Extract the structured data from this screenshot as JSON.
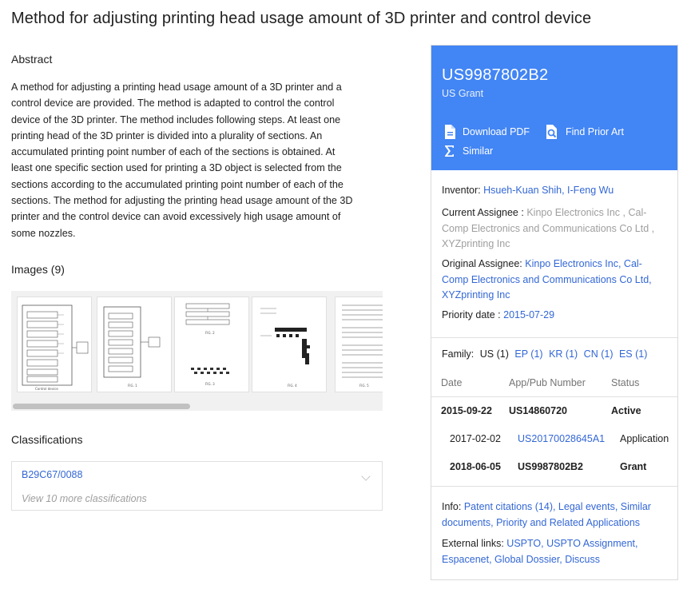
{
  "title": "Method for adjusting printing head usage amount of 3D printer and control device",
  "abstract": {
    "heading": "Abstract",
    "lines": [
      "A method for adjusting a printing head usage amount of a 3D printer and a",
      "control device are provided. The method is adapted to control the control",
      "device of the 3D printer. The method includes following steps. At least one",
      "printing head of the 3D printer is divided into a plurality of sections. An",
      "accumulated printing point number of each of the sections is obtained. At",
      "least one specific section used for printing a 3D object is selected from the",
      "sections according to the accumulated printing point number of each of the",
      "sections. The method for adjusting the printing head usage amount of the 3D",
      "printer and the control device can avoid excessively high usage amount of",
      "some nozzles."
    ]
  },
  "images": {
    "heading": "Images (9)",
    "thumbnails": [
      {
        "caption": "Control device"
      },
      {
        "caption": "FIG. 1"
      },
      {
        "caption": "FIG. 2"
      },
      {
        "caption": "FIG. 3"
      },
      {
        "caption": "FIG. 4"
      },
      {
        "caption": "FIG. 5"
      }
    ],
    "scroll_position": 0.0
  },
  "classifications": {
    "heading": "Classifications",
    "code": "B29C67/0088",
    "more": "View 10 more classifications"
  },
  "sidebar": {
    "pub_number": "US9987802B2",
    "kind": "US Grant",
    "actions": {
      "download": "Download PDF",
      "prior_art": "Find Prior Art",
      "similar": "Similar"
    },
    "inventor_label": "Inventor:",
    "inventors": "Hsueh-Kuan Shih, I-Feng Wu",
    "current_assignee_label": "Current Assignee :",
    "current_assignee_l1": "Kinpo Electronics Inc , Cal-",
    "current_assignee_l2": "Comp Electronics and Communications Co Ltd ,",
    "current_assignee_l3": "XYZprinting Inc",
    "original_assignee_label": "Original Assignee:",
    "original_assignee_l1": "Kinpo Electronics Inc, Cal-",
    "original_assignee_l2": "Comp Electronics and Communications Co Ltd,",
    "original_assignee_l3": "XYZprinting Inc",
    "priority_label": "Priority date :",
    "priority_date": "2015-07-29",
    "family_label": "Family:",
    "family_us": "US (1)",
    "family_links": [
      "EP (1)",
      "KR (1)",
      "CN (1)",
      "ES (1)"
    ],
    "table_headers": {
      "date": "Date",
      "number": "App/Pub Number",
      "status": "Status"
    },
    "table_rows": [
      {
        "date": "2015-09-22",
        "number": "US14860720",
        "status": "Active"
      },
      {
        "date": "2017-02-02",
        "number": "US20170028645A1",
        "status": "Application"
      },
      {
        "date": "2018-06-05",
        "number": "US9987802B2",
        "status": "Grant"
      }
    ],
    "info_label": "Info:",
    "info_links_l1": "Patent citations (14), Legal events, Similar",
    "info_links_l2": "documents, Priority and Related Applications",
    "external_label": "External links:",
    "external_links_l1": "USPTO, USPTO Assignment,",
    "external_links_l2": "Espacenet, Global Dossier, Discuss"
  },
  "colors": {
    "accent": "#4285f4",
    "link": "#3367d6",
    "muted": "#9e9e9e"
  }
}
